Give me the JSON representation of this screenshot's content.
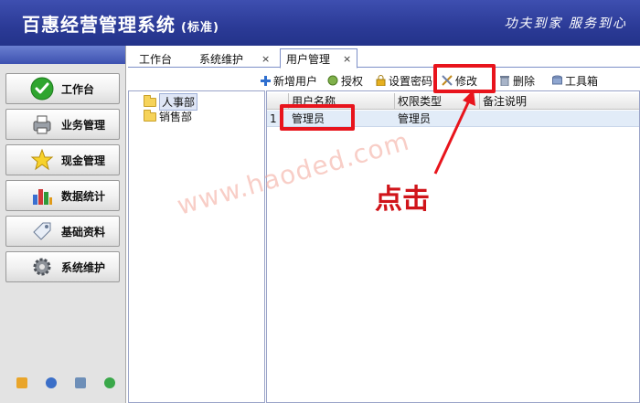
{
  "header": {
    "title": "百惠经营管理系统",
    "edition": "(标准)",
    "slogan": "功夫到家 服务到心"
  },
  "sidebar": {
    "items": [
      {
        "label": "工作台",
        "icon": "check-circle-icon"
      },
      {
        "label": "业务管理",
        "icon": "printer-icon"
      },
      {
        "label": "现金管理",
        "icon": "star-icon"
      },
      {
        "label": "数据统计",
        "icon": "bar-chart-icon"
      },
      {
        "label": "基础资料",
        "icon": "tag-icon"
      },
      {
        "label": "系统维护",
        "icon": "gear-icon"
      }
    ],
    "bottom_icons": [
      "folder-icon",
      "clock-icon",
      "monitor-icon",
      "refresh-icon"
    ]
  },
  "tabs": [
    {
      "label": "工作台"
    },
    {
      "label": "系统维护",
      "close": "×"
    },
    {
      "label": "用户管理",
      "close": "×"
    }
  ],
  "toolbar": {
    "add": "新增用户",
    "grant": "授权",
    "password": "设置密码",
    "edit": "修改",
    "delete": "删除",
    "toolbox": "工具箱"
  },
  "tree": {
    "items": [
      {
        "label": "人事部",
        "selected": true
      },
      {
        "label": "销售部",
        "selected": false
      }
    ]
  },
  "grid": {
    "columns": [
      "用户名称",
      "权限类型",
      "备注说明"
    ],
    "rows": [
      {
        "index": "1",
        "name": "管理员",
        "type": "管理员",
        "remark": ""
      }
    ]
  },
  "annotation": {
    "click_text": "点击",
    "watermark": "www.haoded.com"
  },
  "colors": {
    "header_blue": "#2b3a96",
    "highlight_red": "#e8141c",
    "selected_row": "#e2ecf8"
  }
}
